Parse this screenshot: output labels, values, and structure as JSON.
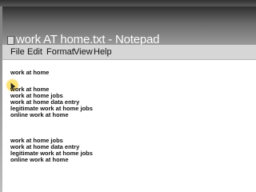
{
  "window": {
    "title": "work AT home.txt - Notepad"
  },
  "menu": {
    "items": [
      "File",
      "Edit",
      "Format",
      "View",
      "Help"
    ]
  },
  "editor": {
    "lines": [
      "work at home",
      "work at home",
      "work at home jobs",
      "work at home data entry",
      "legitimate work at home jobs",
      "online work at home",
      "work at home jobs",
      "work at home data entry",
      "legitimate work at home jobs",
      "online work at home"
    ]
  },
  "icons": {
    "app": "notepad-icon",
    "pointer": "mouse-pointer-icon"
  },
  "colors": {
    "highlight": "#f5c518",
    "titlebar": "#5a5a5a",
    "menubar": "#d6d6d6"
  }
}
